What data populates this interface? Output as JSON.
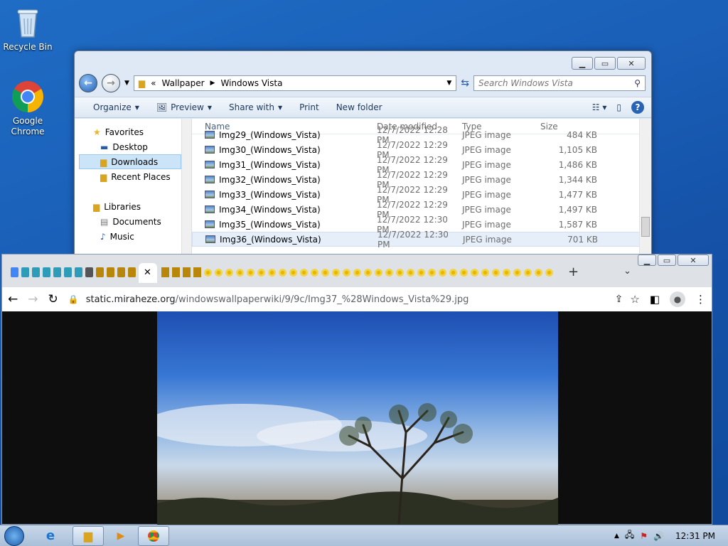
{
  "desktop": {
    "icons": [
      {
        "label": "Recycle Bin",
        "icon": "recycle-bin-icon"
      },
      {
        "label": "Google Chrome",
        "icon": "chrome-icon"
      }
    ]
  },
  "explorer": {
    "breadcrumb": [
      "Wallpaper",
      "Windows Vista"
    ],
    "search_placeholder": "Search Windows Vista",
    "toolbar": {
      "organize": "Organize",
      "preview": "Preview",
      "share_with": "Share with",
      "print": "Print",
      "new_folder": "New folder"
    },
    "navpane": {
      "favorites": "Favorites",
      "desktop": "Desktop",
      "downloads": "Downloads",
      "recent": "Recent Places",
      "libraries": "Libraries",
      "documents": "Documents",
      "music": "Music"
    },
    "columns": {
      "name": "Name",
      "date": "Date modified",
      "type": "Type",
      "size": "Size"
    },
    "files": [
      {
        "name": "Img29_(Windows_Vista)",
        "date": "12/7/2022 12:28 PM",
        "type": "JPEG image",
        "size": "484 KB"
      },
      {
        "name": "Img30_(Windows_Vista)",
        "date": "12/7/2022 12:29 PM",
        "type": "JPEG image",
        "size": "1,105 KB"
      },
      {
        "name": "Img31_(Windows_Vista)",
        "date": "12/7/2022 12:29 PM",
        "type": "JPEG image",
        "size": "1,486 KB"
      },
      {
        "name": "Img32_(Windows_Vista)",
        "date": "12/7/2022 12:29 PM",
        "type": "JPEG image",
        "size": "1,344 KB"
      },
      {
        "name": "Img33_(Windows_Vista)",
        "date": "12/7/2022 12:29 PM",
        "type": "JPEG image",
        "size": "1,477 KB"
      },
      {
        "name": "Img34_(Windows_Vista)",
        "date": "12/7/2022 12:29 PM",
        "type": "JPEG image",
        "size": "1,497 KB"
      },
      {
        "name": "Img35_(Windows_Vista)",
        "date": "12/7/2022 12:30 PM",
        "type": "JPEG image",
        "size": "1,587 KB"
      },
      {
        "name": "Img36_(Windows_Vista)",
        "date": "12/7/2022 12:30 PM",
        "type": "JPEG image",
        "size": "701 KB"
      }
    ]
  },
  "chrome": {
    "url_host": "static.miraheze.org",
    "url_path": "/windowswallpaperwiki/9/9c/Img37_%28Windows_Vista%29.jpg",
    "active_tab_close": "✕",
    "new_tab": "+"
  },
  "taskbar": {
    "clock": "12:31 PM"
  },
  "colors": {
    "desktop_bg": "#1a5fb8",
    "selection": "#cce4f7",
    "chrome_tabstrip": "#dee1e6"
  }
}
